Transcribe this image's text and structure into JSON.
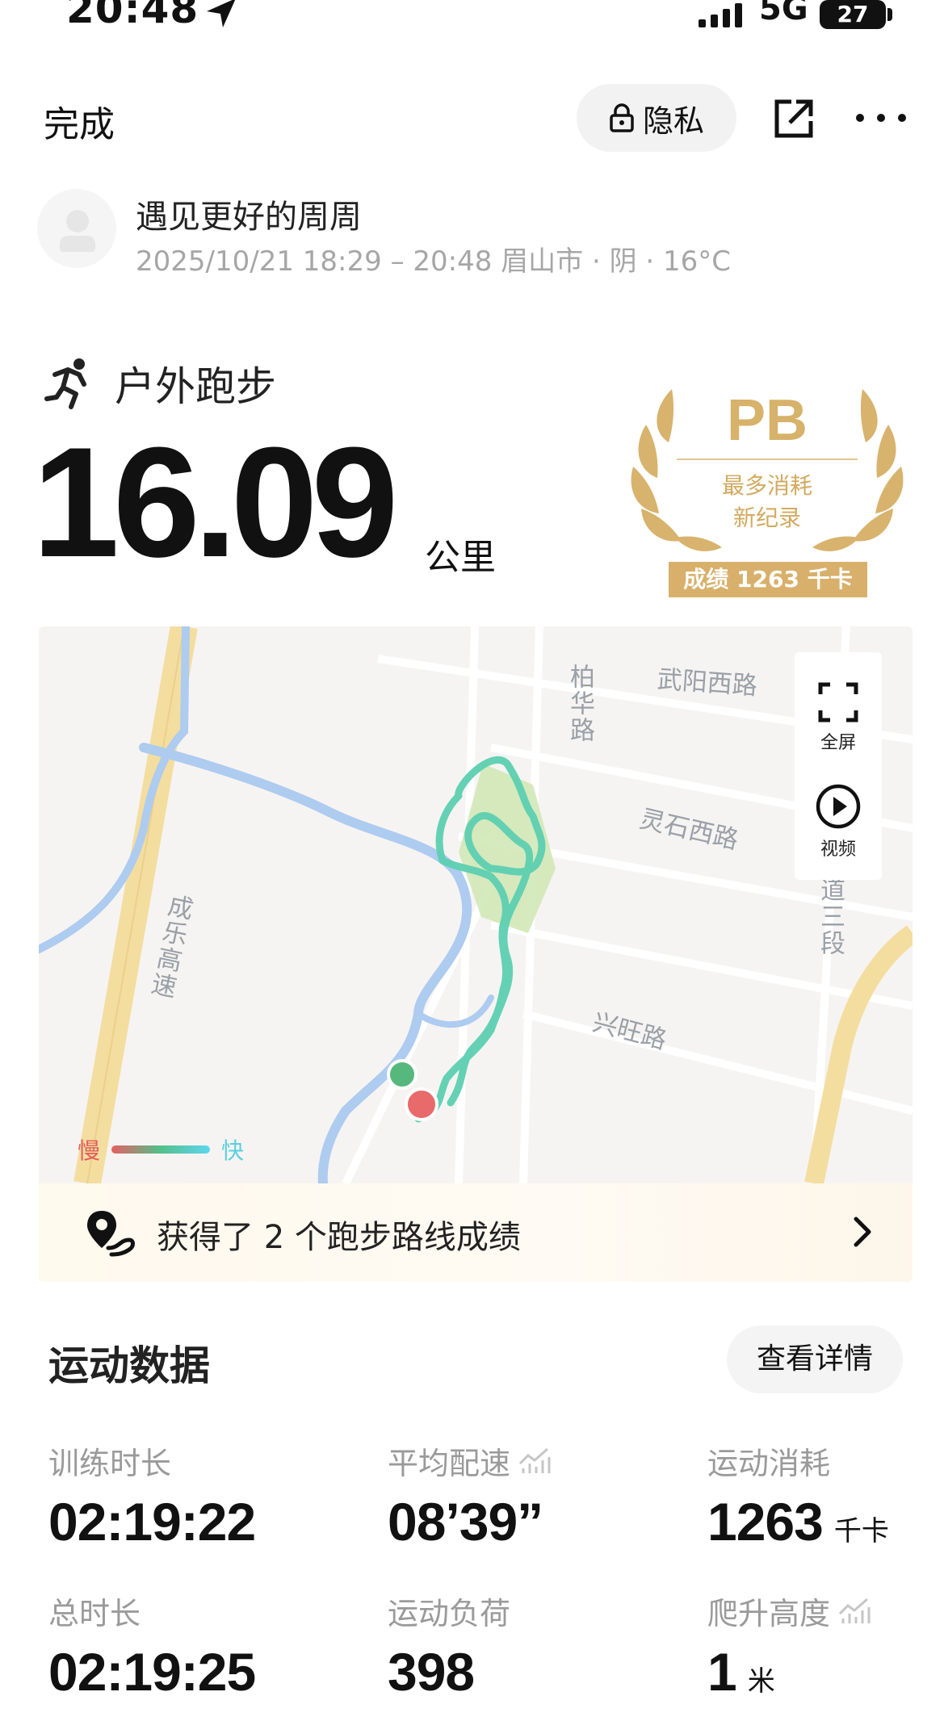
{
  "status_bar": {
    "time": "20:48",
    "network": "5G",
    "battery": "27"
  },
  "nav": {
    "done_label": "完成",
    "privacy_label": "隐私"
  },
  "user": {
    "name": "遇见更好的周周",
    "meta": "2025/10/21 18:29 – 20:48 眉山市 · 阴 · 16°C"
  },
  "activity": {
    "type": "户外跑步",
    "distance": "16.09",
    "distance_unit": "公里"
  },
  "pb_badge": {
    "title": "PB",
    "subtitle_line1": "最多消耗",
    "subtitle_line2": "新纪录",
    "record": "成绩 1263 千卡"
  },
  "map": {
    "labels": {
      "baihua_road": "柏华路",
      "wuyang_west_road": "武阳西路",
      "lingshi_west_road": "灵石西路",
      "section_3": "道三段",
      "xingwang_road": "兴旺路",
      "chengle_highway": "成乐高速"
    },
    "fullscreen_label": "全屏",
    "video_label": "视频",
    "speed_slow": "慢",
    "speed_fast": "快",
    "colors": {
      "route": "#5dcfb0",
      "start": "#56b87c",
      "end": "#e86a6a",
      "river": "#aecbf0",
      "highway": "#f3dea0"
    }
  },
  "route_banner": {
    "text": "获得了 2 个跑步路线成绩"
  },
  "stats_section": {
    "title": "运动数据",
    "details_label": "查看详情"
  },
  "stats": {
    "train_duration": {
      "label": "训练时长",
      "value": "02:19:22"
    },
    "avg_pace": {
      "label": "平均配速",
      "value": "08’39”"
    },
    "calories": {
      "label": "运动消耗",
      "value": "1263",
      "unit": "千卡"
    },
    "total_duration": {
      "label": "总时长",
      "value": "02:19:25"
    },
    "load": {
      "label": "运动负荷",
      "value": "398"
    },
    "elevation": {
      "label": "爬升高度",
      "value": "1",
      "unit": "米"
    }
  }
}
